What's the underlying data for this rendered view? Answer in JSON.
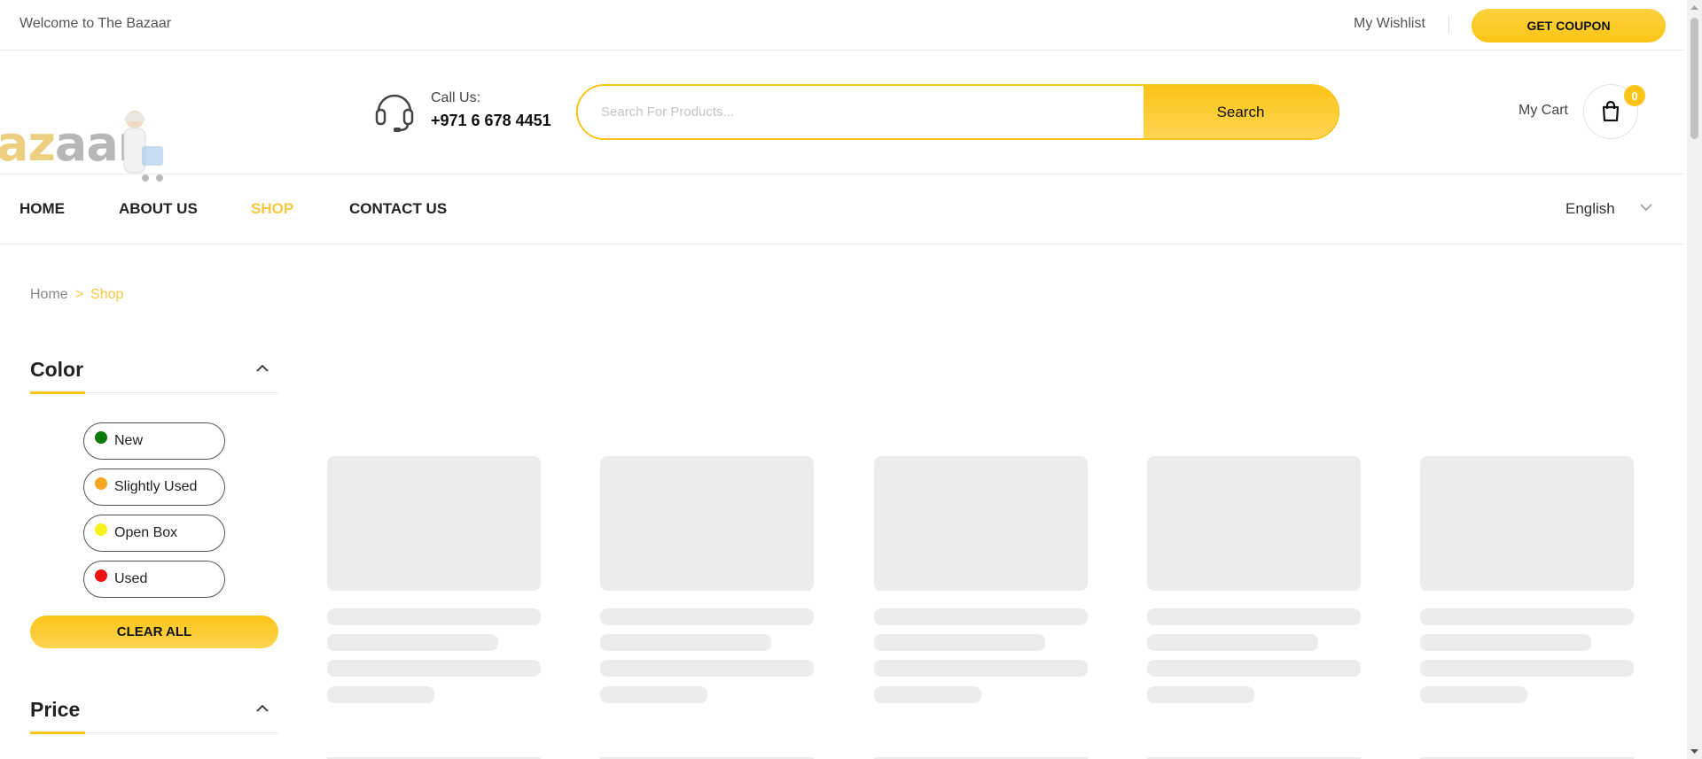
{
  "topbar": {
    "welcome": "Welcome to The Bazaar",
    "wishlist": "My Wishlist",
    "coupon": "GET COUPON"
  },
  "header": {
    "logo_text_main": "az",
    "logo_text_rest": "aar",
    "call_label": "Call Us:",
    "call_number": "+971 6 678 4451",
    "search_placeholder": "Search For Products...",
    "search_button": "Search",
    "cart_label": "My Cart",
    "cart_count": "0"
  },
  "nav": {
    "items": [
      {
        "label": "HOME",
        "active": false
      },
      {
        "label": "ABOUT US",
        "active": false
      },
      {
        "label": "SHOP",
        "active": true
      },
      {
        "label": "CONTACT US",
        "active": false
      }
    ],
    "language": "English"
  },
  "breadcrumb": {
    "home": "Home",
    "separator": ">",
    "current": "Shop"
  },
  "filters": {
    "color": {
      "title": "Color",
      "options": [
        {
          "label": "New",
          "color": "#0a7a0a"
        },
        {
          "label": "Slightly Used",
          "color": "#f5a623"
        },
        {
          "label": "Open Box",
          "color": "#f7f21c"
        },
        {
          "label": "Used",
          "color": "#ee1111"
        }
      ],
      "clear_all": "CLEAR ALL"
    },
    "price": {
      "title": "Price"
    }
  },
  "products": {
    "state": "loading",
    "placeholder_count": 5
  },
  "colors": {
    "accent": "#fcc417",
    "active_link": "#f6c944",
    "skeleton": "#ececec"
  }
}
